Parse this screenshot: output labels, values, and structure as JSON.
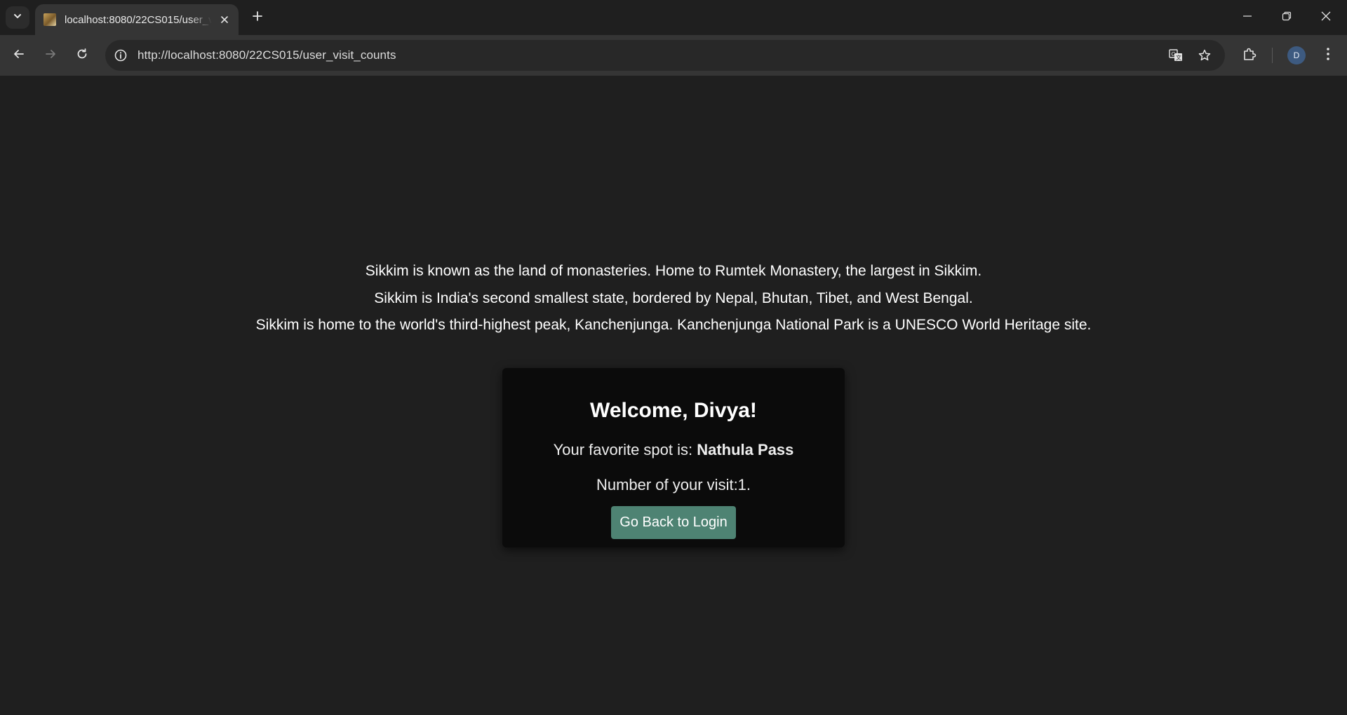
{
  "browser": {
    "tab": {
      "title": "localhost:8080/22CS015/user_visit_counts",
      "favicon": "favicon-icon"
    },
    "omnibox": {
      "url": "http://localhost:8080/22CS015/user_visit_counts"
    },
    "profile": {
      "initial": "D"
    }
  },
  "page": {
    "facts": [
      "Sikkim is known as the land of monasteries. Home to Rumtek Monastery, the largest in Sikkim.",
      "Sikkim is India's second smallest state, bordered by Nepal, Bhutan, Tibet, and West Bengal.",
      "Sikkim is home to the world's third-highest peak, Kanchenjunga. Kanchenjunga National Park is a UNESCO World Heritage site."
    ],
    "card": {
      "welcome": "Welcome, Divya!",
      "spot_prefix": "Your favorite spot is: ",
      "spot_name": "Nathula Pass",
      "visits": "Number of your visit:1.",
      "button_label": "Go Back to Login"
    }
  },
  "colors": {
    "background": "#1f1f1f",
    "card": "#0b0b0b",
    "button": "#4e8373"
  }
}
